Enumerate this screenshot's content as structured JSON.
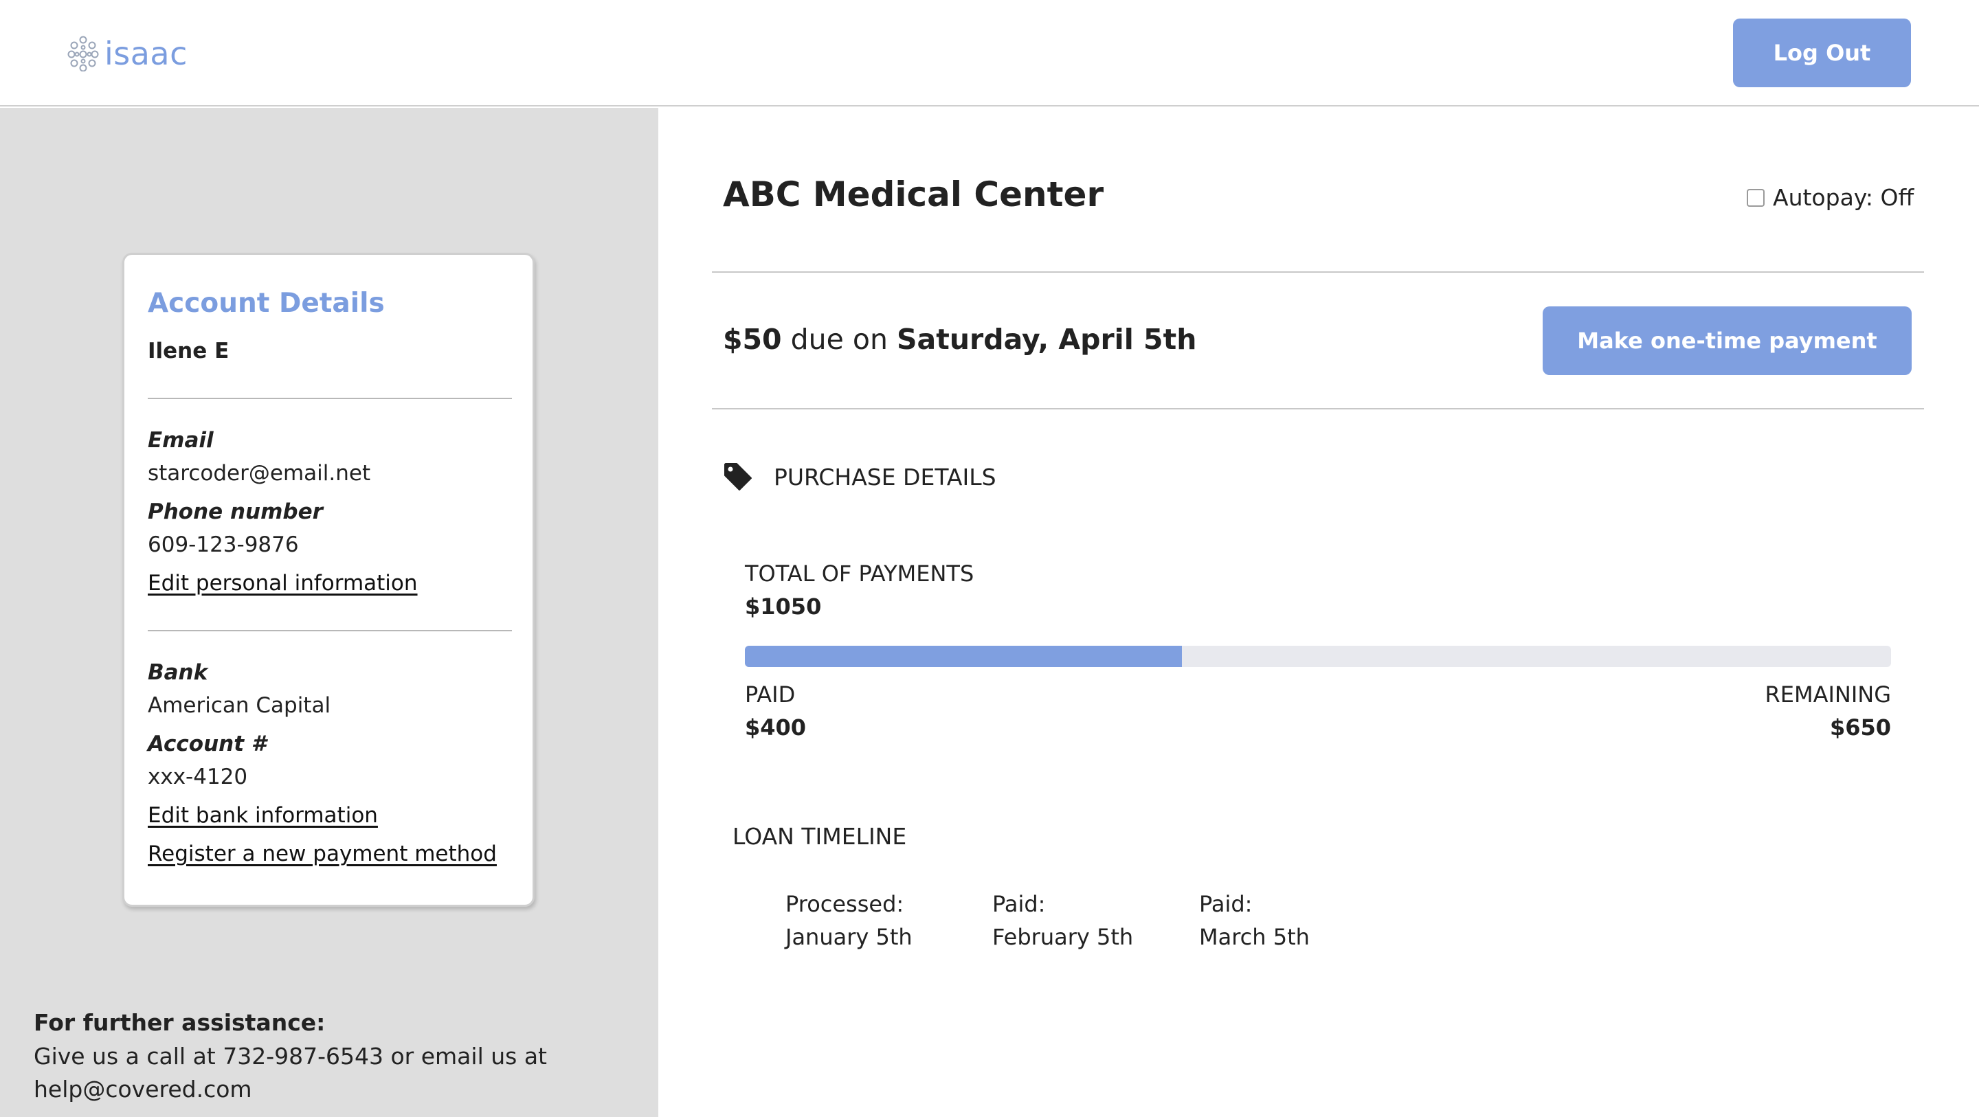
{
  "header": {
    "logo_text": "isaac",
    "logout_label": "Log Out"
  },
  "account": {
    "title": "Account Details",
    "name": "Ilene E",
    "email_label": "Email",
    "email_value": "starcoder@email.net",
    "phone_label": "Phone number",
    "phone_value": "609-123-9876",
    "edit_personal_link": "Edit personal information",
    "bank_label": "Bank",
    "bank_value": "American Capital",
    "account_label": "Account #",
    "account_value": "xxx-4120",
    "edit_bank_link": "Edit bank information",
    "register_link": "Register a new payment method"
  },
  "assistance": {
    "title": "For further assistance:",
    "line1": "Give us a call at 732-987-6543 or email us at",
    "line2": "help@covered.com"
  },
  "main": {
    "merchant": "ABC Medical Center",
    "autopay_label": "Autopay: Off",
    "autopay_checked": false,
    "due_amount": "$50",
    "due_text": "due on",
    "due_date": "Saturday, April 5th",
    "pay_button_label": "Make one-time payment",
    "purchase_details_label": "PURCHASE DETAILS",
    "total_label": "TOTAL OF PAYMENTS",
    "total_value": "$1050",
    "paid_label": "PAID",
    "paid_value": "$400",
    "remaining_label": "REMAINING",
    "remaining_value": "$650",
    "progress_fraction": 0.381,
    "timeline_label": "LOAN TIMELINE",
    "timeline": [
      {
        "status": "Processed:",
        "date": "January 5th"
      },
      {
        "status": "Paid:",
        "date": "February 5th"
      },
      {
        "status": "Paid:",
        "date": "March 5th"
      }
    ]
  },
  "colors": {
    "accent": "#7f9fe0",
    "sidebar_bg": "#dedede",
    "track": "#e8e9ee"
  }
}
